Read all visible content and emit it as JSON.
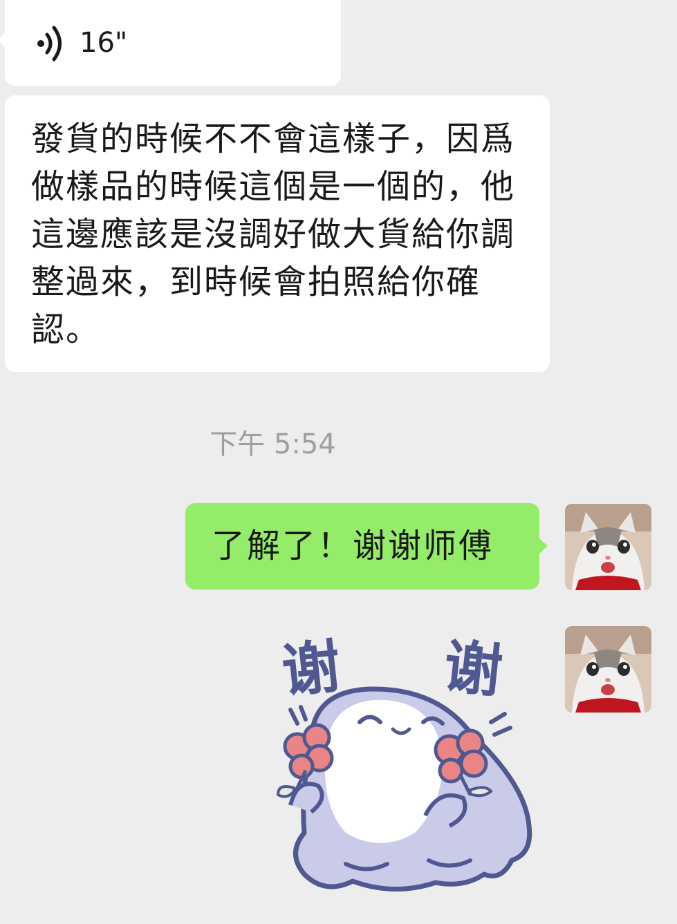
{
  "voice_message": {
    "duration": "16\"",
    "icon": "voice-wave-icon"
  },
  "text_message": {
    "text": "發貨的時候不不會這樣子，因爲做樣品的時候這個是一個的，他這邊應該是沒調好做大貨給你調整過來，到時候會拍照給你確認。"
  },
  "timestamp": "下午 5:54",
  "outgoing_message": {
    "text": "了解了！谢谢师傅"
  },
  "sticker": {
    "text_left": "谢",
    "text_right": "谢"
  },
  "colors": {
    "background": "#ededed",
    "incoming_bubble": "#ffffff",
    "outgoing_bubble": "#95ec69",
    "timestamp": "#9e9e9e",
    "sticker_outline": "#4f5890"
  }
}
